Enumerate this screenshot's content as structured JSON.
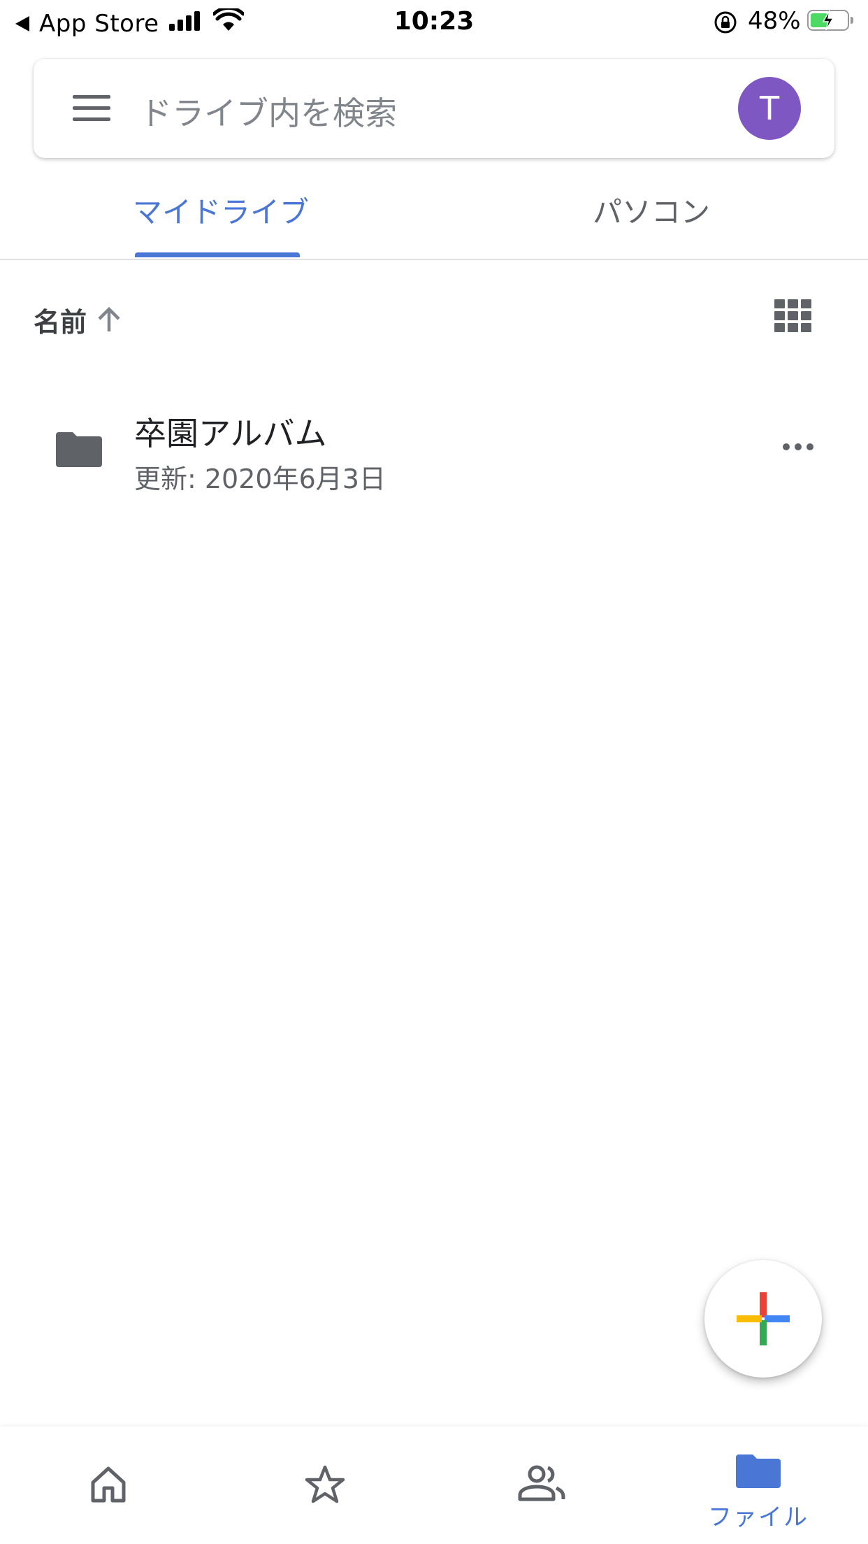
{
  "status_bar": {
    "back_app": "App Store",
    "time": "10:23",
    "battery_percent": "48%",
    "battery_level": 0.48,
    "battery_color": "#4cd964"
  },
  "search": {
    "placeholder": "ドライブ内を検索",
    "avatar_letter": "T",
    "avatar_color": "#7e57c2"
  },
  "tabs": [
    {
      "label": "マイドライブ",
      "active": true
    },
    {
      "label": "パソコン",
      "active": false
    }
  ],
  "sort": {
    "label": "名前",
    "direction_icon": "arrow-up-icon"
  },
  "files": [
    {
      "name": "卒園アルバム",
      "modified": "更新: 2020年6月3日",
      "icon": "folder-icon"
    }
  ],
  "fab": {
    "icon": "plus-icon"
  },
  "bottom_nav": {
    "items": [
      {
        "icon": "home-icon",
        "label": ""
      },
      {
        "icon": "star-icon",
        "label": ""
      },
      {
        "icon": "shared-people-icon",
        "label": ""
      },
      {
        "icon": "folder-icon",
        "label": "ファイル",
        "active": true
      }
    ]
  },
  "colors": {
    "accent": "#4a76d6",
    "icon_gray": "#5f6368"
  }
}
